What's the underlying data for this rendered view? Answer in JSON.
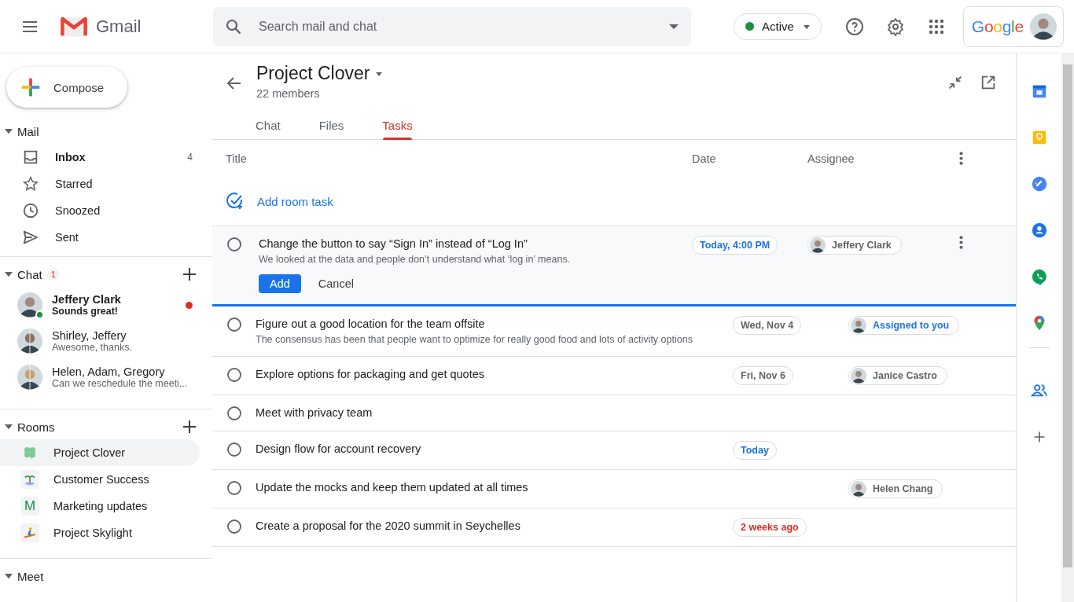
{
  "header": {
    "product": "Gmail",
    "search": {
      "placeholder": "Search mail and chat"
    },
    "status": {
      "label": "Active",
      "color": "#1e8e3e"
    },
    "account": {
      "brand": "Google"
    }
  },
  "sidebar": {
    "compose": "Compose",
    "mail": {
      "title": "Mail",
      "expanded": true,
      "items": [
        {
          "label": "Inbox",
          "unread": true,
          "count": "4"
        },
        {
          "label": "Starred",
          "unread": false
        },
        {
          "label": "Snoozed",
          "unread": false
        },
        {
          "label": "Sent",
          "unread": false
        }
      ]
    },
    "chat": {
      "title": "Chat",
      "expanded": true,
      "badge": "1",
      "items": [
        {
          "name": "Jeffery Clark",
          "preview": "Sounds great!",
          "unread": true,
          "online": true
        },
        {
          "name": "Shirley, Jeffery",
          "preview": "Awesome, thanks.",
          "unread": false,
          "online": false
        },
        {
          "name": "Helen, Adam, Gregory",
          "preview": "Can we reschedule the meeti...",
          "unread": false,
          "online": false
        }
      ]
    },
    "rooms": {
      "title": "Rooms",
      "expanded": true,
      "items": [
        {
          "name": "Project Clover",
          "selected": true
        },
        {
          "name": "Customer Success",
          "selected": false
        },
        {
          "name": "Marketing updates",
          "letter": "M",
          "selected": false
        },
        {
          "name": "Project Skylight",
          "selected": false
        }
      ]
    },
    "meet": {
      "title": "Meet",
      "expanded": true
    }
  },
  "room": {
    "title": "Project Clover",
    "members": "22 members",
    "tabs": [
      {
        "label": "Chat",
        "selected": false
      },
      {
        "label": "Files",
        "selected": false
      },
      {
        "label": "Tasks",
        "selected": true
      }
    ],
    "table": {
      "columns": [
        "Title",
        "Date",
        "Assignee"
      ],
      "add_task": "Add room task",
      "rows": [
        {
          "kind": "editing",
          "done": false,
          "title": "Change the button to say “Sign In” instead of “Log In”",
          "description": "We looked at the data and people don’t understand what ‘log in’ means.",
          "date": {
            "text": "Today, 4:00 PM",
            "color": "#1a73e8"
          },
          "assignee": "Jeffery Clark",
          "assigned_to_you": false,
          "actions": [
            "Add",
            "Cancel"
          ]
        },
        {
          "kind": "task",
          "done": false,
          "title": "Figure out a good location for the team offsite",
          "description": "The consensus has been that people want to optimize for really good food and lots of activity options",
          "date": {
            "text": "Wed, Nov 4",
            "color": "#5f6368"
          },
          "assignee": "Assigned to you",
          "assigned_to_you": true
        },
        {
          "kind": "task",
          "done": false,
          "title": "Explore options for packaging and get quotes",
          "date": {
            "text": "Fri, Nov 6",
            "color": "#5f6368"
          },
          "assignee": "Janice Castro",
          "assigned_to_you": false
        },
        {
          "kind": "task",
          "done": false,
          "title": "Meet with privacy team"
        },
        {
          "kind": "task",
          "done": false,
          "title": "Design flow for account recovery",
          "date": {
            "text": "Today",
            "color": "#1a73e8"
          }
        },
        {
          "kind": "task",
          "done": false,
          "title": "Update the mocks and keep them updated at all times",
          "assignee": "Helen Chang",
          "assigned_to_you": false
        },
        {
          "kind": "task",
          "done": false,
          "title": "Create a proposal for the 2020 summit in Seychelles",
          "date": {
            "text": "2 weeks ago",
            "color": "#d93025"
          }
        }
      ]
    }
  }
}
